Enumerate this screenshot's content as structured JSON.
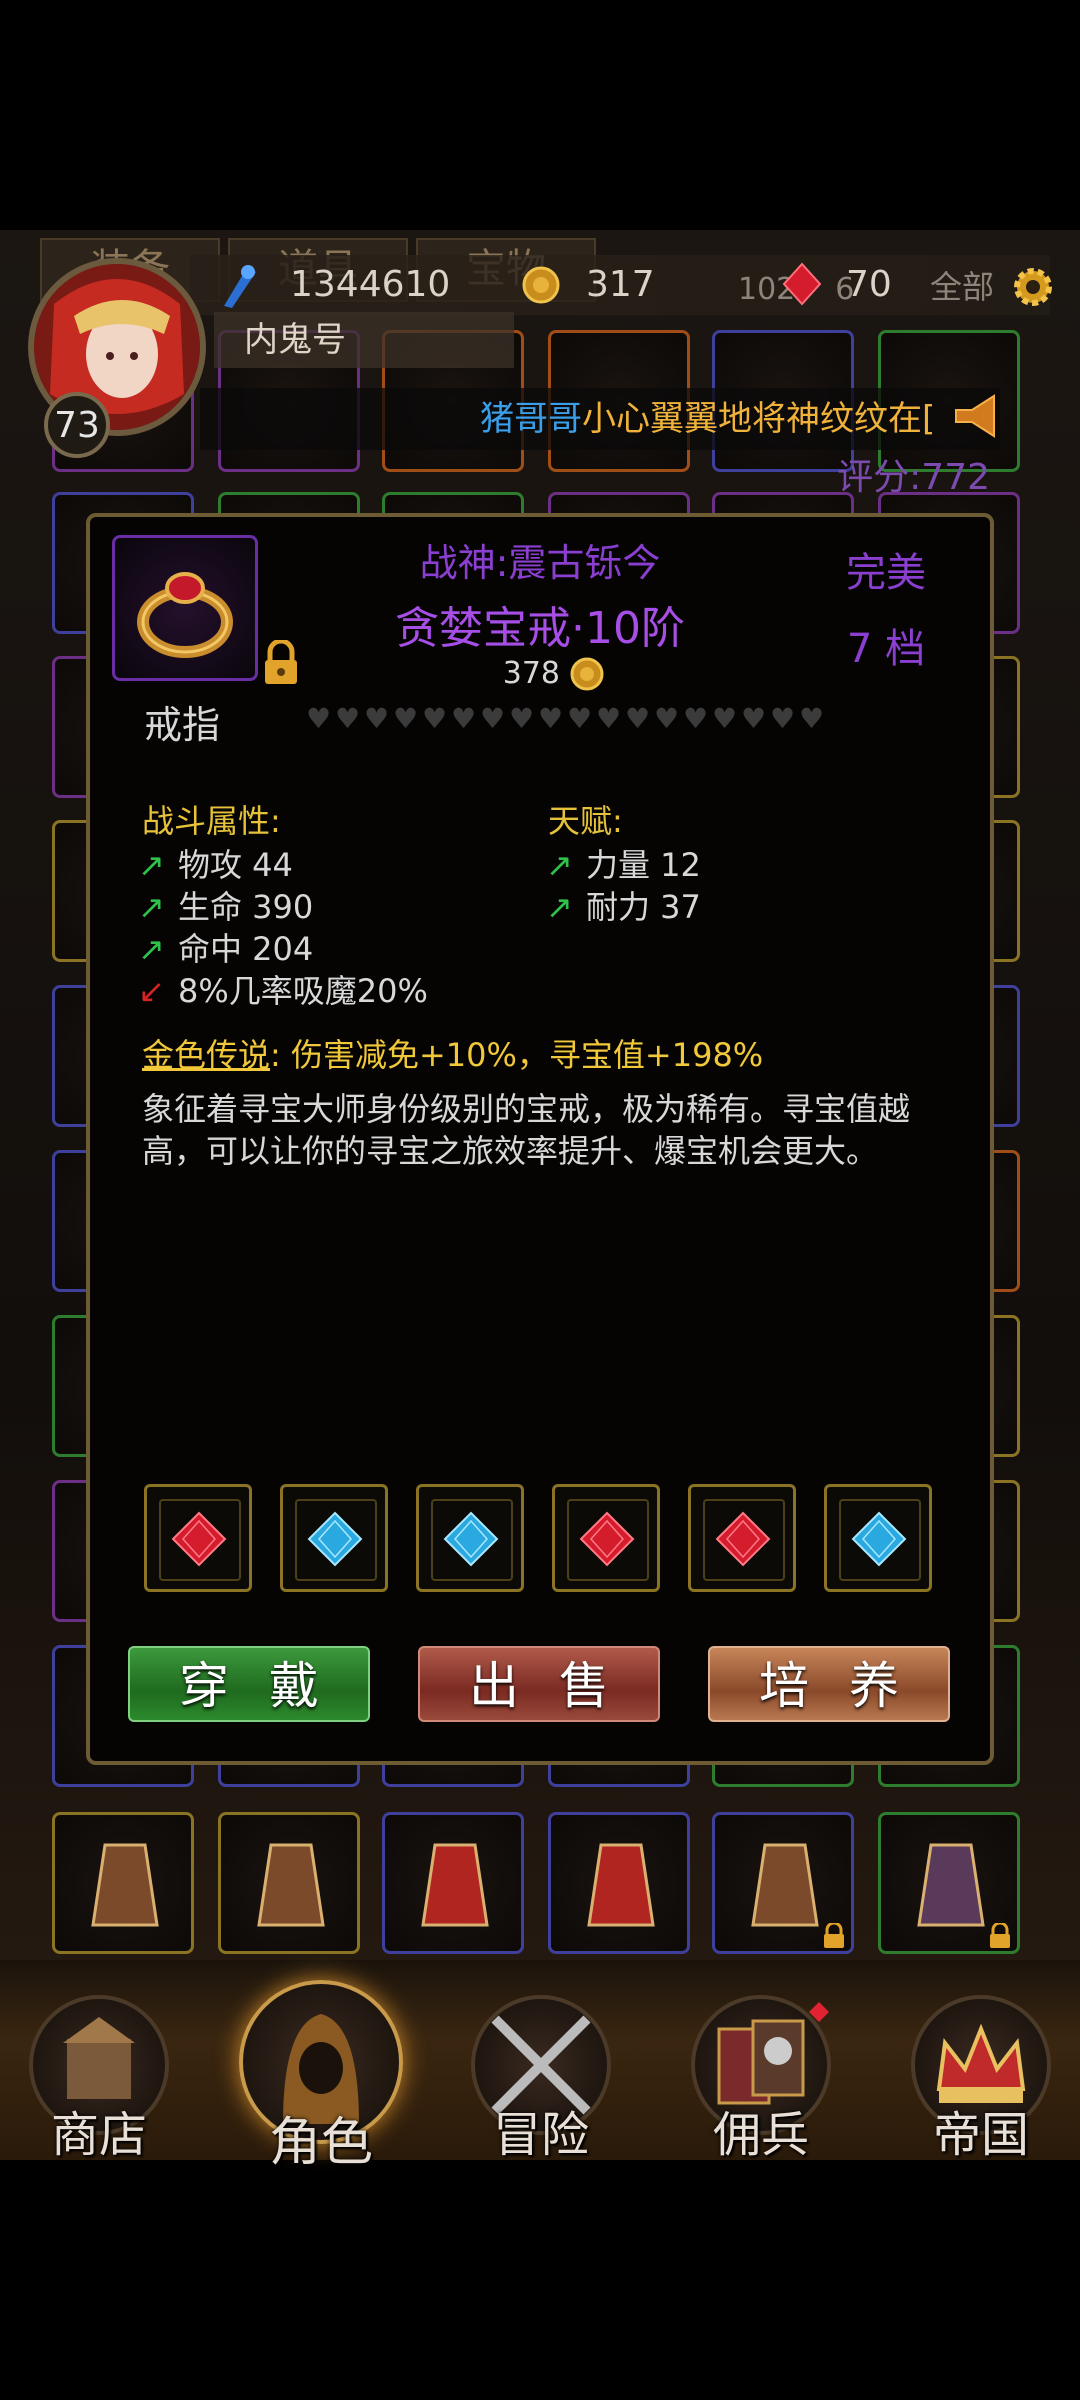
{
  "top_bar": {
    "tabs": [
      "装备",
      "道具",
      "宝物"
    ],
    "mana": "1344610",
    "coins": "317",
    "gem_total_partial": "102",
    "gem_total_tail": "6",
    "gems": "70",
    "filter": "全部"
  },
  "player": {
    "level": "73",
    "name": "内鬼号"
  },
  "ticker": {
    "player_name": "猪哥哥",
    "message": "小心翼翼地将神纹纹在["
  },
  "score": "评分:772",
  "item": {
    "set_name": "战神:震古铄今",
    "title": "贪婪宝戒·10阶",
    "price": "378",
    "quality": "完美",
    "grade": "7 档",
    "slot_type": "戒指",
    "hearts": 18,
    "combat_header": "战斗属性:",
    "talent_header": "天赋:",
    "combat_stats": [
      {
        "text": "物攻 44",
        "dir": "up"
      },
      {
        "text": "生命 390",
        "dir": "up"
      },
      {
        "text": "命中 204",
        "dir": "up"
      },
      {
        "text": "8%几率吸魔20%",
        "dir": "down"
      }
    ],
    "talents": [
      {
        "text": "力量 12",
        "dir": "up"
      },
      {
        "text": "耐力 37",
        "dir": "up"
      }
    ],
    "legend_label": "金色传说",
    "legend_text": ": 伤害减免+10%，寻宝值+198%",
    "description": "象征着寻宝大师身份级别的宝戒，极为稀有。寻宝值越高，可以让你的寻宝之旅效率提升、爆宝机会更大。",
    "gem_sockets": [
      "red",
      "blue",
      "blue",
      "red",
      "red",
      "blue"
    ]
  },
  "actions": {
    "equip": "穿戴",
    "sell": "出售",
    "train": "培养"
  },
  "nav": [
    "商店",
    "角色",
    "冒险",
    "佣兵",
    "帝国"
  ],
  "colors": {
    "set_name": "#8a3fd1",
    "title": "#a64ee6",
    "stat_header": "#e6c23a",
    "stat_text": "#d8d8d8",
    "stat_up": "#2fc24a",
    "stat_down": "#d42424",
    "legend": "#f0c83a",
    "ticker_name": "#3a9ee8",
    "ticker_msg": "#f0b23a"
  }
}
